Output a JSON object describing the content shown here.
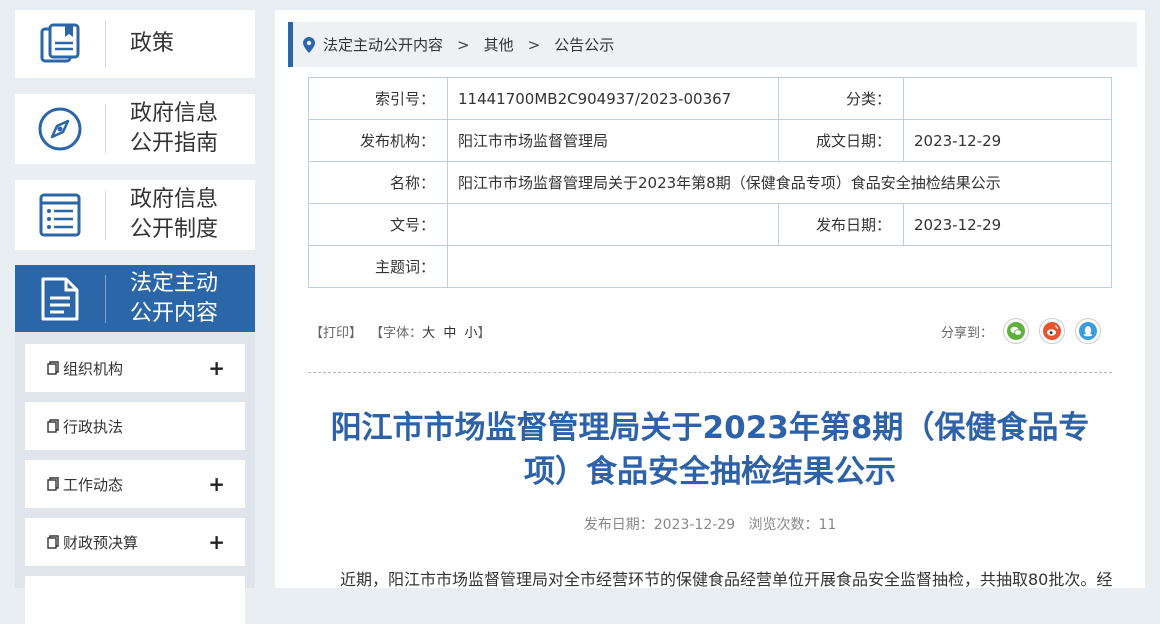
{
  "sidebar": {
    "cards": [
      {
        "label": "政策",
        "icon": "policy-book-icon"
      },
      {
        "label": "政府信息\n公开指南",
        "icon": "compass-icon"
      },
      {
        "label": "政府信息\n公开制度",
        "icon": "list-document-icon"
      },
      {
        "label": "法定主动\n公开内容",
        "icon": "document-icon"
      }
    ],
    "sub_items": [
      {
        "label": "组织机构",
        "expand": "+"
      },
      {
        "label": "行政执法",
        "expand": ""
      },
      {
        "label": "工作动态",
        "expand": "+"
      },
      {
        "label": "财政预决算",
        "expand": "+"
      }
    ]
  },
  "breadcrumb": {
    "items": [
      "法定主动公开内容",
      "其他",
      "公告公示"
    ],
    "separator": ">"
  },
  "meta": {
    "index_label": "索引号：",
    "index_value": "11441700MB2C904937/2023-00367",
    "category_label": "分类：",
    "category_value": "",
    "publisher_label": "发布机构：",
    "publisher_value": "阳江市市场监督管理局",
    "written_date_label": "成文日期：",
    "written_date_value": "2023-12-29",
    "name_label": "名称：",
    "name_value": "阳江市市场监督管理局关于2023年第8期（保健食品专项）食品安全抽检结果公示",
    "docno_label": "文号：",
    "docno_value": "",
    "pub_date_label": "发布日期：",
    "pub_date_value": "2023-12-29",
    "keywords_label": "主题词：",
    "keywords_value": ""
  },
  "tools": {
    "print": "【打印】",
    "font_prefix": "【字体：",
    "large": "大",
    "medium": "中",
    "small": "小",
    "font_suffix": "】",
    "share_label": "分享到："
  },
  "article": {
    "title_line1": "阳江市市场监督管理局关于2023年第8期（保健食品专",
    "title_line2": "项）食品安全抽检结果公示",
    "pub_info": "发布日期：2023-12-29   浏览次数：11",
    "body": "近期，阳江市市场监督管理局对全市经营环节的保健食品经营单位开展食品安全监督抽检，共抽取80批次。经"
  },
  "colors": {
    "accent": "#2b66a8",
    "title": "#2e62a8",
    "wechat": "#5fb13b",
    "weibo": "#e8542d",
    "qq": "#3b9de0"
  }
}
